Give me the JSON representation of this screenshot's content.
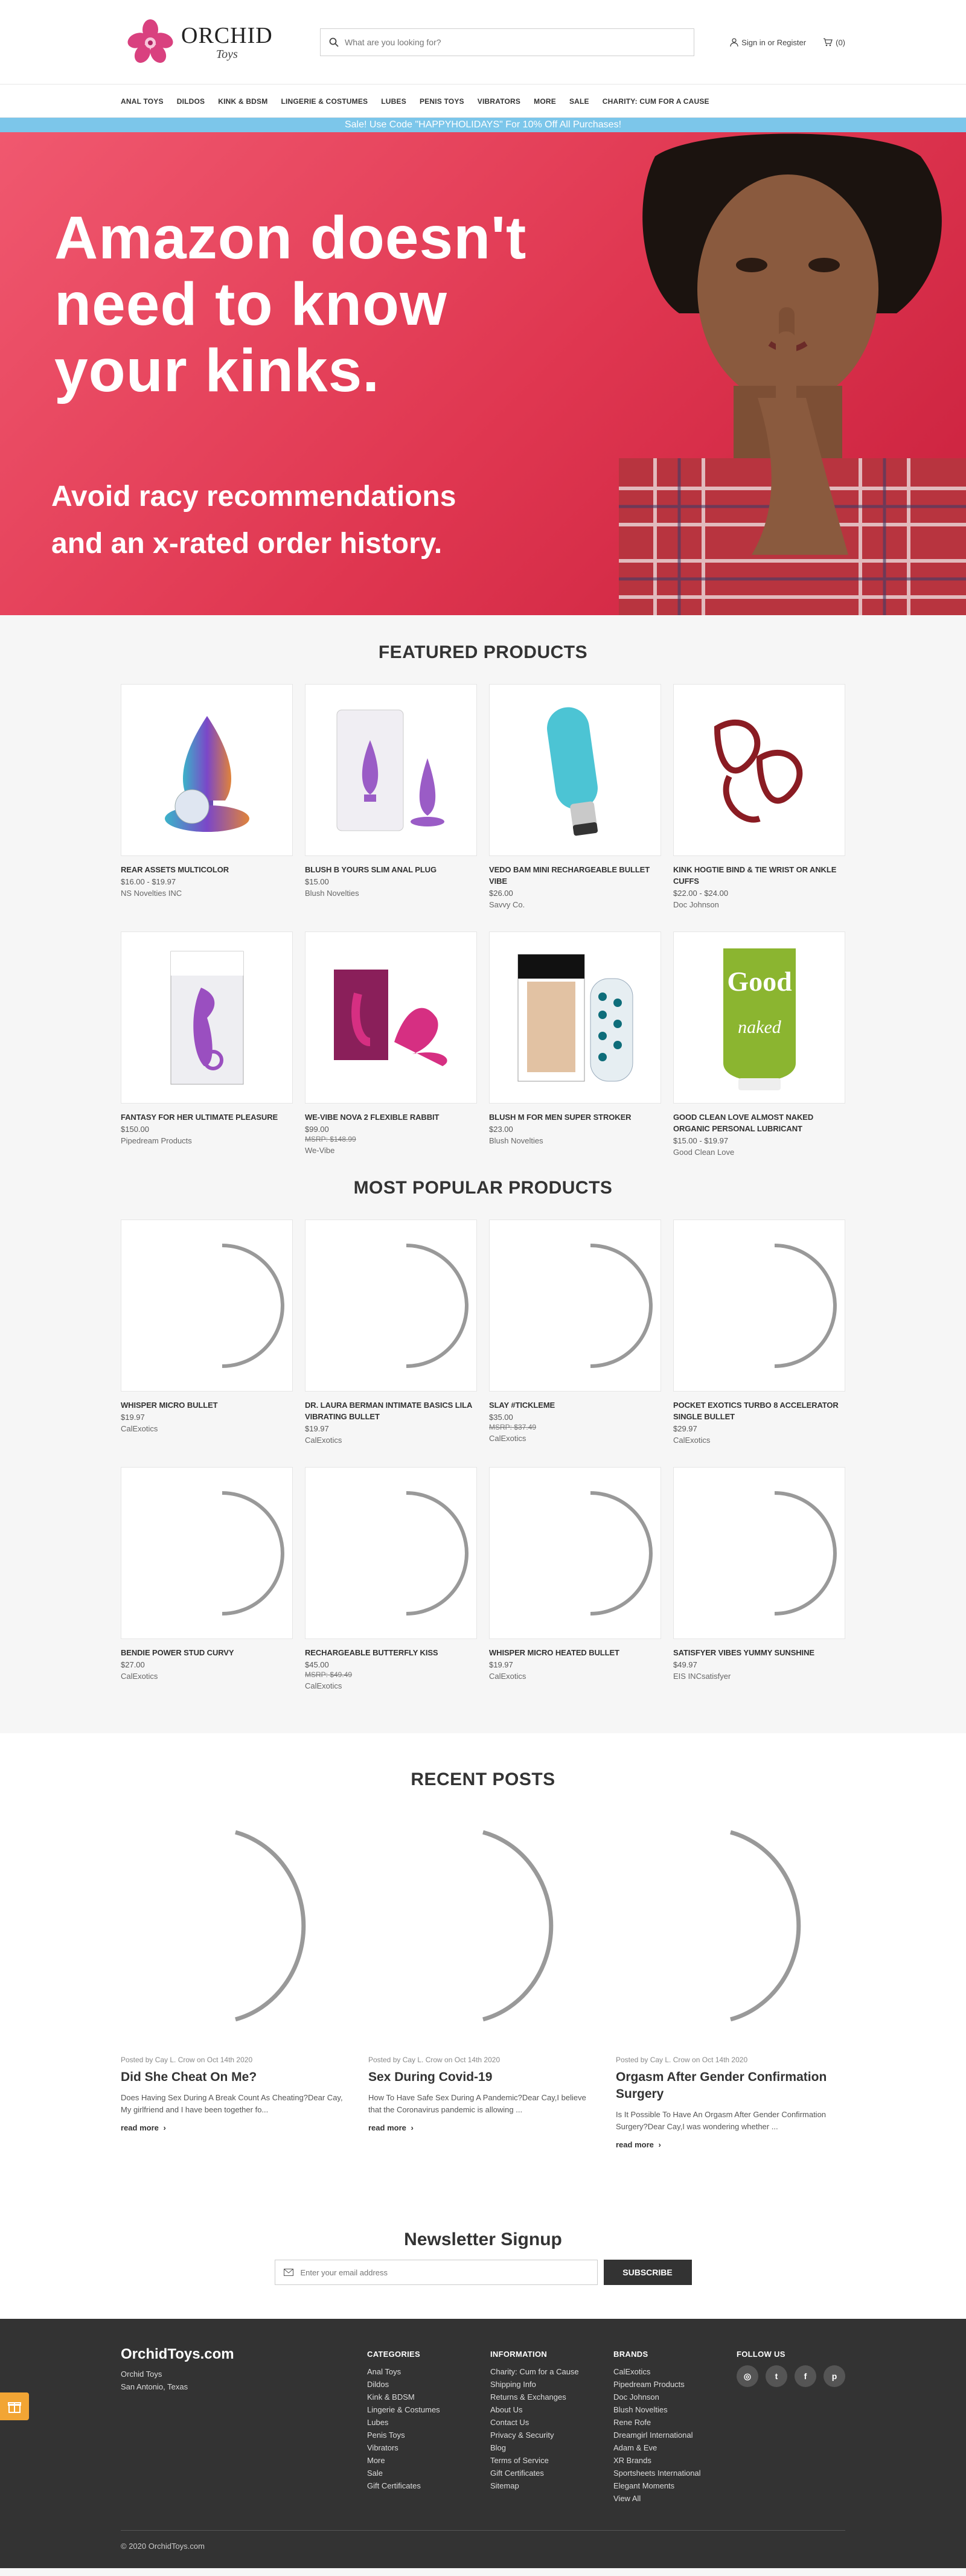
{
  "header": {
    "logo_big": "ORCHID",
    "logo_small": "Toys",
    "search_placeholder": "What are you looking for?",
    "account_label": "Sign in or Register",
    "cart_label": "(0)"
  },
  "nav": [
    "ANAL TOYS",
    "DILDOS",
    "KINK & BDSM",
    "LINGERIE & COSTUMES",
    "LUBES",
    "PENIS TOYS",
    "VIBRATORS",
    "MORE",
    "SALE",
    "CHARITY: CUM FOR A CAUSE"
  ],
  "promo": "Sale! Use Code \"HAPPYHOLIDAYS\" For 10% Off All Purchases!",
  "hero": {
    "line1": "Amazon doesn't",
    "line2": "need to know",
    "line3": "your kinks.",
    "sub1": "Avoid racy recommendations",
    "sub2": "and an x-rated order history."
  },
  "featured": {
    "title": "FEATURED PRODUCTS",
    "items": [
      {
        "name": "REAR ASSETS MULTICOLOR",
        "price": "$16.00 - $19.97",
        "msrp": "",
        "brand": "NS Novelties INC"
      },
      {
        "name": "BLUSH B YOURS SLIM ANAL PLUG",
        "price": "$15.00",
        "msrp": "",
        "brand": "Blush Novelties"
      },
      {
        "name": "VEDO BAM MINI RECHARGEABLE BULLET VIBE",
        "price": "$26.00",
        "msrp": "",
        "brand": "Savvy Co."
      },
      {
        "name": "KINK HOGTIE BIND & TIE WRIST OR ANKLE CUFFS",
        "price": "$22.00 - $24.00",
        "msrp": "",
        "brand": "Doc Johnson"
      },
      {
        "name": "FANTASY FOR HER ULTIMATE PLEASURE",
        "price": "$150.00",
        "msrp": "",
        "brand": "Pipedream Products"
      },
      {
        "name": "WE-VIBE NOVA 2 FLEXIBLE RABBIT",
        "price": "$99.00",
        "msrp": "MSRP: $148.99",
        "brand": "We-Vibe"
      },
      {
        "name": "BLUSH M FOR MEN SUPER STROKER",
        "price": "$23.00",
        "msrp": "",
        "brand": "Blush Novelties"
      },
      {
        "name": "GOOD CLEAN LOVE ALMOST NAKED ORGANIC PERSONAL LUBRICANT",
        "price": "$15.00 - $19.97",
        "msrp": "",
        "brand": "Good Clean Love"
      }
    ]
  },
  "popular": {
    "title": "MOST POPULAR PRODUCTS",
    "items": [
      {
        "name": "WHISPER MICRO BULLET",
        "price": "$19.97",
        "msrp": "",
        "brand": "CalExotics"
      },
      {
        "name": "DR. LAURA BERMAN INTIMATE BASICS LILA VIBRATING BULLET",
        "price": "$19.97",
        "msrp": "",
        "brand": "CalExotics"
      },
      {
        "name": "SLAY #TICKLEME",
        "price": "$35.00",
        "msrp": "MSRP: $37.49",
        "brand": "CalExotics"
      },
      {
        "name": "POCKET EXOTICS TURBO 8 ACCELERATOR SINGLE BULLET",
        "price": "$29.97",
        "msrp": "",
        "brand": "CalExotics"
      },
      {
        "name": "BENDIE POWER STUD CURVY",
        "price": "$27.00",
        "msrp": "",
        "brand": "CalExotics"
      },
      {
        "name": "RECHARGEABLE BUTTERFLY KISS",
        "price": "$45.00",
        "msrp": "MSRP: $49.49",
        "brand": "CalExotics"
      },
      {
        "name": "WHISPER MICRO HEATED BULLET",
        "price": "$19.97",
        "msrp": "",
        "brand": "CalExotics"
      },
      {
        "name": "SATISFYER VIBES YUMMY SUNSHINE",
        "price": "$49.97",
        "msrp": "",
        "brand": "EIS INCsatisfyer"
      }
    ]
  },
  "posts": {
    "title": "RECENT POSTS",
    "more_label": "read more",
    "items": [
      {
        "meta": "Posted by Cay L. Crow on Oct 14th 2020",
        "title": "Did She Cheat On Me?",
        "excerpt": "Does Having Sex During A Break Count As Cheating?Dear Cay, My girlfriend and I have been together fo..."
      },
      {
        "meta": "Posted by Cay L. Crow on Oct 14th 2020",
        "title": "Sex During Covid-19",
        "excerpt": "How To Have Safe Sex During A Pandemic?Dear Cay,I believe that the Coronavirus pandemic is allowing ..."
      },
      {
        "meta": "Posted by Cay L. Crow on Oct 14th 2020",
        "title": "Orgasm After Gender Confirmation Surgery",
        "excerpt": "Is It Possible To Have An Orgasm After Gender Confirmation Surgery?Dear Cay,I was wondering whether ..."
      }
    ]
  },
  "newsletter": {
    "title": "Newsletter Signup",
    "placeholder": "Enter your email address",
    "button": "SUBSCRIBE"
  },
  "footer": {
    "brand_title": "OrchidToys.com",
    "brand_lines": [
      "Orchid Toys",
      "San Antonio, Texas"
    ],
    "categories_title": "CATEGORIES",
    "categories": [
      "Anal Toys",
      "Dildos",
      "Kink & BDSM",
      "Lingerie & Costumes",
      "Lubes",
      "Penis Toys",
      "Vibrators",
      "More",
      "Sale",
      "Gift Certificates"
    ],
    "info_title": "INFORMATION",
    "info": [
      "Charity: Cum for a Cause",
      "Shipping Info",
      "Returns & Exchanges",
      "About Us",
      "Contact Us",
      "Privacy & Security",
      "Blog",
      "Terms of Service",
      "Gift Certificates",
      "Sitemap"
    ],
    "brands_title": "BRANDS",
    "brands": [
      "CalExotics",
      "Pipedream Products",
      "Doc Johnson",
      "Blush Novelties",
      "Rene Rofe",
      "Dreamgirl International",
      "Adam & Eve",
      "XR Brands",
      "Sportsheets International",
      "Elegant Moments",
      "View All"
    ],
    "follow_title": "FOLLOW US",
    "social": [
      "instagram-icon",
      "twitter-icon",
      "facebook-icon",
      "pinterest-icon"
    ],
    "copyright": "© 2020 OrchidToys.com"
  },
  "colors": {
    "promo": "#7cc6ea",
    "hero": "#e23a54",
    "footer": "#333333",
    "gift": "#f2a534"
  }
}
